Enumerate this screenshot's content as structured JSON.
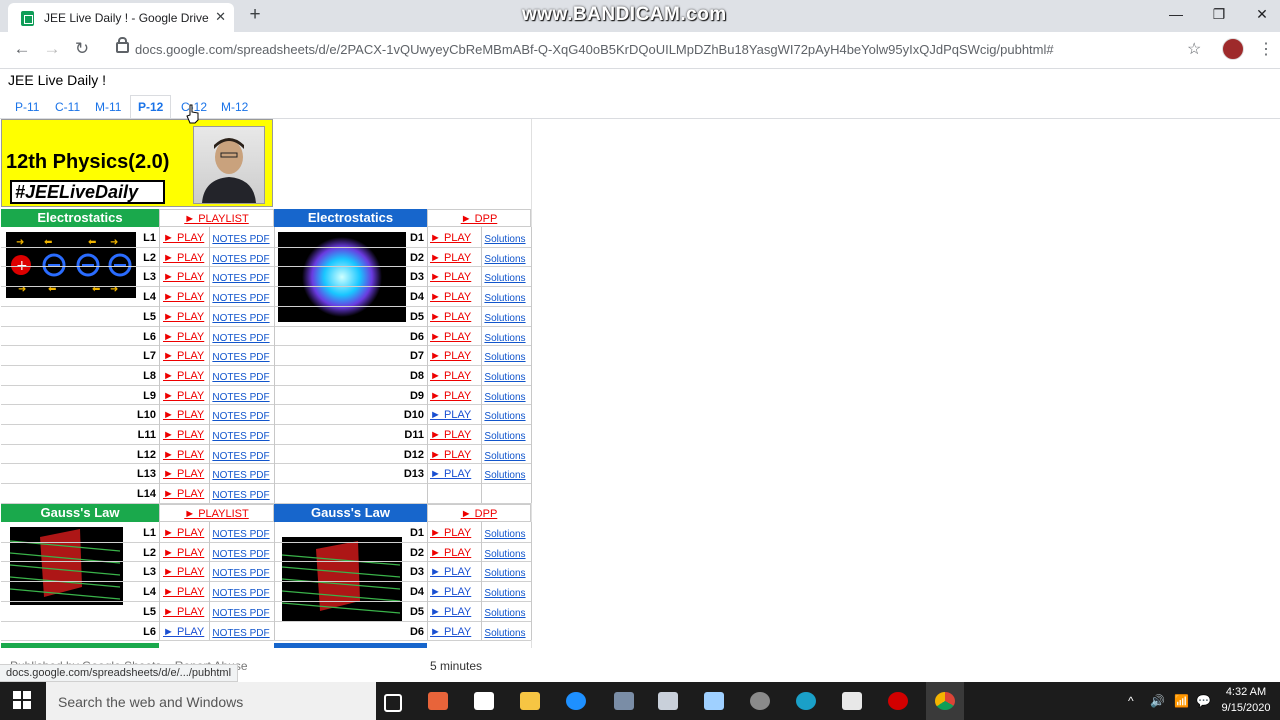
{
  "browser": {
    "tab_title": "JEE Live Daily ! - Google Drive",
    "tab_close": "✕",
    "new_tab": "+",
    "watermark": "www.BANDICAM.com",
    "url": "docs.google.com/spreadsheets/d/e/2PACX-1vQUwyeyCbReMBmABf-Q-XqG40oB5KrDQoUILMpDZhBu18YasgWI72pAyH4beYolw95yIxQJdPqSWcig/pubhtml#",
    "back": "←",
    "forward": "→",
    "reload": "↻",
    "star": "☆",
    "menu": "⋮",
    "minimize": "—",
    "restore": "❐",
    "close": "✕"
  },
  "sheet": {
    "doc_title": "JEE Live Daily !",
    "tabs": [
      {
        "label": "P-11"
      },
      {
        "label": "C-11"
      },
      {
        "label": "M-11"
      },
      {
        "label": "P-12"
      },
      {
        "label": "C-12"
      },
      {
        "label": "M-12"
      }
    ],
    "active_tab": "P-12",
    "header": {
      "title": "12th Physics(2.0)",
      "hashtag": "#JEELiveDaily"
    },
    "sections": [
      {
        "left_title": "Electrostatics",
        "left_link": "► PLAYLIST",
        "right_title": "Electrostatics",
        "right_link": "► DPP",
        "lectures": [
          "L1",
          "L2",
          "L3",
          "L4",
          "L5",
          "L6",
          "L7",
          "L8",
          "L9",
          "L10",
          "L11",
          "L12",
          "L13",
          "L14"
        ],
        "lecture_play": [
          "► PLAY",
          "► PLAY",
          "► PLAY",
          "► PLAY",
          "► PLAY",
          "► PLAY",
          "► PLAY",
          "► PLAY",
          "► PLAY",
          "► PLAY",
          "► PLAY",
          "► PLAY",
          "► PLAY",
          "► PLAY"
        ],
        "lecture_notes": [
          "NOTES PDF",
          "NOTES PDF",
          "NOTES PDF",
          "NOTES PDF",
          "NOTES PDF",
          "NOTES PDF",
          "NOTES PDF",
          "NOTES PDF",
          "NOTES PDF",
          "NOTES PDF",
          "NOTES PDF",
          "NOTES PDF",
          "NOTES PDF",
          "NOTES PDF"
        ],
        "dpps": [
          "D1",
          "D2",
          "D3",
          "D4",
          "D5",
          "D6",
          "D7",
          "D8",
          "D9",
          "D10",
          "D11",
          "D12",
          "D13"
        ],
        "dpp_play": [
          "► PLAY",
          "► PLAY",
          "► PLAY",
          "► PLAY",
          "► PLAY",
          "► PLAY",
          "► PLAY",
          "► PLAY",
          "► PLAY",
          "► PLAY",
          "► PLAY",
          "► PLAY",
          "► PLAY"
        ],
        "dpp_play_blue": [
          false,
          false,
          false,
          false,
          false,
          false,
          false,
          false,
          false,
          true,
          false,
          false,
          true
        ],
        "dpp_solutions": [
          "Solutions",
          "Solutions",
          "Solutions",
          "Solutions",
          "Solutions",
          "Solutions",
          "Solutions",
          "Solutions",
          "Solutions",
          "Solutions",
          "Solutions",
          "Solutions",
          "Solutions"
        ]
      },
      {
        "left_title": "Gauss's Law",
        "left_link": "► PLAYLIST",
        "right_title": "Gauss's Law",
        "right_link": "► DPP",
        "lectures": [
          "L1",
          "L2",
          "L3",
          "L4",
          "L5",
          "L6"
        ],
        "lecture_play": [
          "► PLAY",
          "► PLAY",
          "► PLAY",
          "► PLAY",
          "► PLAY",
          "► PLAY"
        ],
        "lecture_play_blue": [
          false,
          false,
          false,
          false,
          false,
          true
        ],
        "lecture_notes": [
          "NOTES PDF",
          "NOTES PDF",
          "NOTES PDF",
          "NOTES PDF",
          "NOTES PDF",
          "NOTES PDF"
        ],
        "dpps": [
          "D1",
          "D2",
          "D3",
          "D4",
          "D5",
          "D6"
        ],
        "dpp_play": [
          "► PLAY",
          "► PLAY",
          "► PLAY",
          "► PLAY",
          "► PLAY",
          "► PLAY"
        ],
        "dpp_play_blue": [
          false,
          false,
          true,
          true,
          true,
          true
        ],
        "dpp_solutions": [
          "Solutions",
          "Solutions",
          "Solutions",
          "Solutions",
          "Solutions",
          "Solutions"
        ]
      }
    ]
  },
  "footer": {
    "published": "Published by Google Sheets – Report Abuse",
    "updated": "5 minutes",
    "status_url": "docs.google.com/spreadsheets/d/e/.../pubhtml"
  },
  "taskbar": {
    "search_placeholder": "Search the web and Windows",
    "time": "4:32 AM",
    "date": "9/15/2020"
  },
  "colors": {
    "green": "#1aa94c",
    "blue": "#1766cc",
    "yellow": "#ffff00",
    "link_red": "#e00000"
  }
}
